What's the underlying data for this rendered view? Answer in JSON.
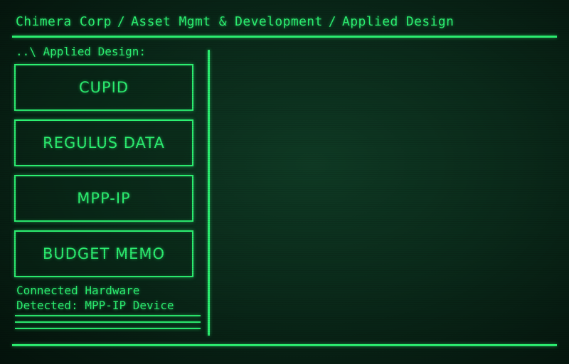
{
  "header": {
    "crumbs": [
      "Chimera Corp",
      "Asset Mgmt & Development",
      "Applied Design"
    ],
    "separator": "/"
  },
  "directory": {
    "label": "..\\ Applied Design:"
  },
  "menu": {
    "items": [
      {
        "label": "CUPID"
      },
      {
        "label": "REGULUS DATA"
      },
      {
        "label": "MPP-IP"
      },
      {
        "label": "BUDGET MEMO"
      }
    ]
  },
  "status": {
    "line1": "Connected Hardware",
    "line2": "Detected: MPP-IP Device"
  },
  "colors": {
    "phosphor": "#2cf071",
    "background": "#0a2a1a"
  }
}
